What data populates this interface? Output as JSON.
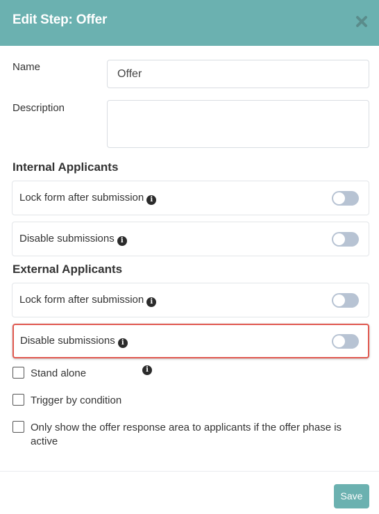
{
  "dialog": {
    "title": "Edit Step: Offer",
    "close_icon": "close-icon"
  },
  "form": {
    "name_label": "Name",
    "name_value": "Offer",
    "description_label": "Description",
    "description_value": ""
  },
  "internal": {
    "title": "Internal Applicants",
    "rows": [
      {
        "label": "Lock form after submission",
        "enabled": false
      },
      {
        "label": "Disable submissions",
        "enabled": false
      }
    ]
  },
  "external": {
    "title": "External Applicants",
    "rows": [
      {
        "label": "Lock form after submission",
        "enabled": false
      },
      {
        "label": "Disable submissions",
        "enabled": false
      }
    ]
  },
  "options": [
    {
      "label": "Stand alone",
      "checked": false
    },
    {
      "label": "Trigger by condition",
      "checked": false
    },
    {
      "label": "Only show the offer response area to applicants if the offer phase is active",
      "checked": false
    }
  ],
  "footer": {
    "save_label": "Save"
  },
  "colors": {
    "header": "#6bb1b0",
    "toggle_off": "#b7c3d3",
    "highlight_border": "#e0574e"
  }
}
